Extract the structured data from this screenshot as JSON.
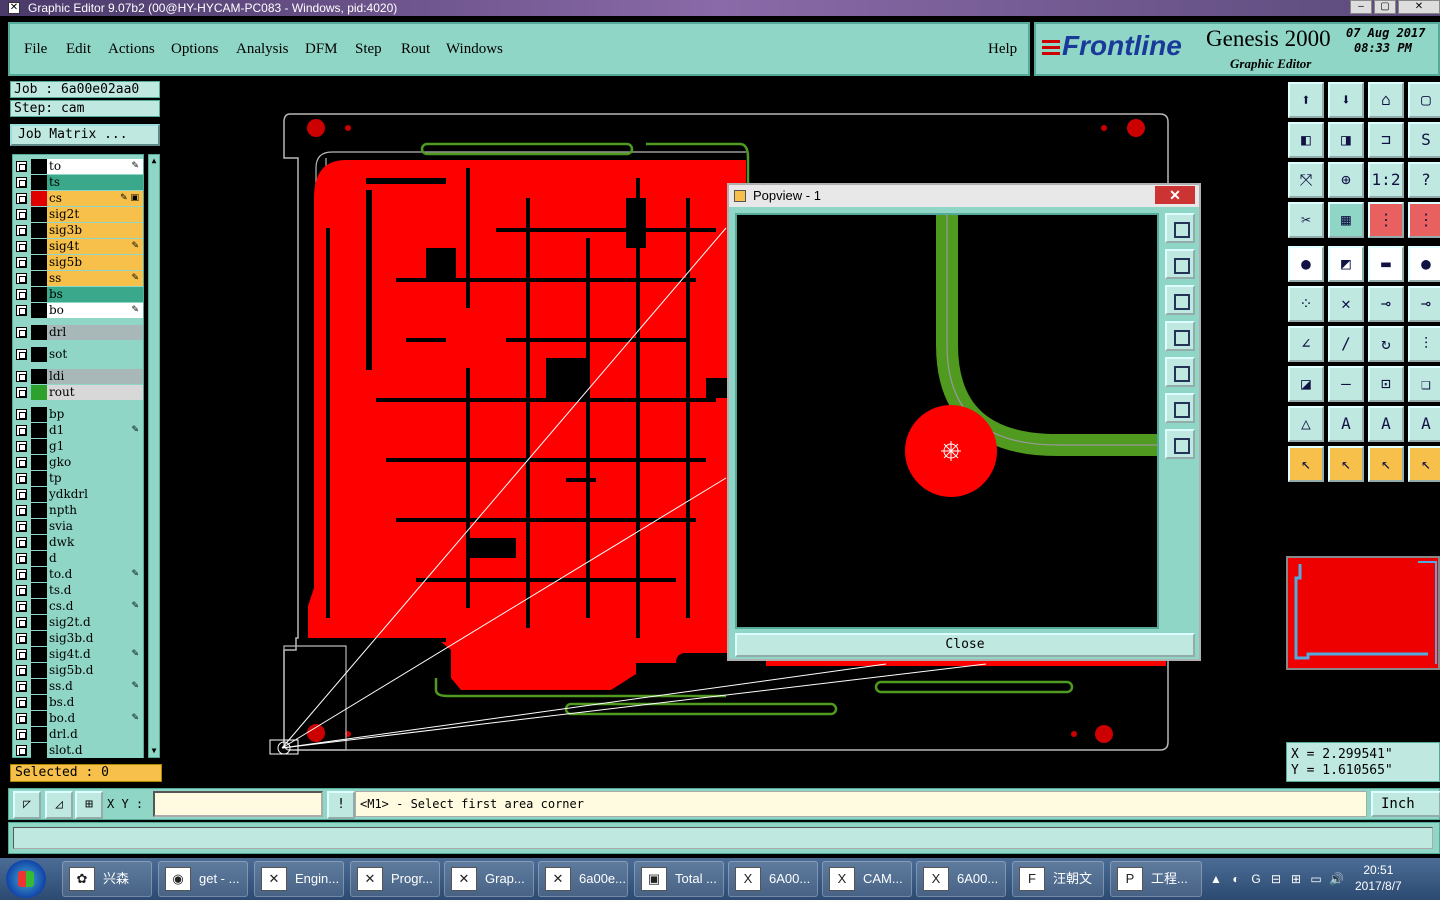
{
  "window": {
    "title": "Graphic Editor 9.07b2 (00@HY-HYCAM-PC083 - Windows, pid:4020)"
  },
  "menu": {
    "items": [
      "File",
      "Edit",
      "Actions",
      "Options",
      "Analysis",
      "DFM",
      "Step",
      "Rout",
      "Windows"
    ],
    "help": "Help"
  },
  "brand": {
    "logo": "Frontline",
    "product": "Genesis 2000",
    "subtitle": "Graphic Editor",
    "date": "07 Aug 2017",
    "time": "08:33 PM"
  },
  "job": {
    "job_line": "Job : 6a00e02aa0",
    "step_line": "Step: cam",
    "matrix_button": "Job Matrix ..."
  },
  "layers": [
    {
      "name": "to",
      "color": "#ffffff",
      "swatch": "#000000",
      "mark": "✎"
    },
    {
      "name": "ts",
      "color": "#3aa88a",
      "swatch": "#000000",
      "mark": ""
    },
    {
      "name": "cs",
      "color": "#f6c04a",
      "swatch": "#e00000",
      "mark": "✎ ▣"
    },
    {
      "name": "sig2t",
      "color": "#f6c04a",
      "swatch": "#000000",
      "mark": ""
    },
    {
      "name": "sig3b",
      "color": "#f6c04a",
      "swatch": "#000000",
      "mark": ""
    },
    {
      "name": "sig4t",
      "color": "#f6c04a",
      "swatch": "#000000",
      "mark": "✎"
    },
    {
      "name": "sig5b",
      "color": "#f6c04a",
      "swatch": "#000000",
      "mark": ""
    },
    {
      "name": "ss",
      "color": "#f6c04a",
      "swatch": "#000000",
      "mark": "✎"
    },
    {
      "name": "bs",
      "color": "#3aa88a",
      "swatch": "#000000",
      "mark": ""
    },
    {
      "name": "bo",
      "color": "#ffffff",
      "swatch": "#000000",
      "mark": "✎"
    },
    {
      "name": "drl",
      "color": "#a8b8b8",
      "swatch": "#000000",
      "mark": ""
    },
    {
      "name": "sot",
      "color": "#8fd6c6",
      "swatch": "#000000",
      "mark": ""
    },
    {
      "name": "ldi",
      "color": "#a8b8b8",
      "swatch": "#000000",
      "mark": ""
    },
    {
      "name": "rout",
      "color": "#d8d8d8",
      "swatch": "#2ea02e",
      "mark": ""
    },
    {
      "name": "bp",
      "color": "#8fd6c6",
      "swatch": "#000000",
      "mark": ""
    },
    {
      "name": "d1",
      "color": "#8fd6c6",
      "swatch": "#000000",
      "mark": "✎"
    },
    {
      "name": "g1",
      "color": "#8fd6c6",
      "swatch": "#000000",
      "mark": ""
    },
    {
      "name": "gko",
      "color": "#8fd6c6",
      "swatch": "#000000",
      "mark": ""
    },
    {
      "name": "tp",
      "color": "#8fd6c6",
      "swatch": "#000000",
      "mark": ""
    },
    {
      "name": "ydkdrl",
      "color": "#8fd6c6",
      "swatch": "#000000",
      "mark": ""
    },
    {
      "name": "npth",
      "color": "#8fd6c6",
      "swatch": "#000000",
      "mark": ""
    },
    {
      "name": "svia",
      "color": "#8fd6c6",
      "swatch": "#000000",
      "mark": ""
    },
    {
      "name": "dwk",
      "color": "#8fd6c6",
      "swatch": "#000000",
      "mark": ""
    },
    {
      "name": "d",
      "color": "#8fd6c6",
      "swatch": "#000000",
      "mark": ""
    },
    {
      "name": "to.d",
      "color": "#8fd6c6",
      "swatch": "#000000",
      "mark": "✎"
    },
    {
      "name": "ts.d",
      "color": "#8fd6c6",
      "swatch": "#000000",
      "mark": ""
    },
    {
      "name": "cs.d",
      "color": "#8fd6c6",
      "swatch": "#000000",
      "mark": "✎"
    },
    {
      "name": "sig2t.d",
      "color": "#8fd6c6",
      "swatch": "#000000",
      "mark": ""
    },
    {
      "name": "sig3b.d",
      "color": "#8fd6c6",
      "swatch": "#000000",
      "mark": ""
    },
    {
      "name": "sig4t.d",
      "color": "#8fd6c6",
      "swatch": "#000000",
      "mark": "✎"
    },
    {
      "name": "sig5b.d",
      "color": "#8fd6c6",
      "swatch": "#000000",
      "mark": ""
    },
    {
      "name": "ss.d",
      "color": "#8fd6c6",
      "swatch": "#000000",
      "mark": "✎"
    },
    {
      "name": "bs.d",
      "color": "#8fd6c6",
      "swatch": "#000000",
      "mark": ""
    },
    {
      "name": "bo.d",
      "color": "#8fd6c6",
      "swatch": "#000000",
      "mark": "✎"
    },
    {
      "name": "drl.d",
      "color": "#8fd6c6",
      "swatch": "#000000",
      "mark": ""
    },
    {
      "name": "slot.d",
      "color": "#8fd6c6",
      "swatch": "#000000",
      "mark": ""
    }
  ],
  "selected": "Selected : 0",
  "popview": {
    "title": "Popview - 1",
    "close_label": "Close",
    "x_label": "✕"
  },
  "toolbar": {
    "tools": [
      {
        "icon": "⬆",
        "bg": "#bfe8e0"
      },
      {
        "icon": "⬇",
        "bg": "#bfe8e0"
      },
      {
        "icon": "⌂",
        "bg": "#bfe8e0"
      },
      {
        "icon": "▢",
        "bg": "#bfe8e0"
      },
      {
        "icon": "◧",
        "bg": "#bfe8e0"
      },
      {
        "icon": "◨",
        "bg": "#bfe8e0"
      },
      {
        "icon": "⊐",
        "bg": "#bfe8e0"
      },
      {
        "icon": "S",
        "bg": "#bfe8e0"
      },
      {
        "icon": "⤧",
        "bg": "#bfe8e0"
      },
      {
        "icon": "⊕",
        "bg": "#bfe8e0"
      },
      {
        "icon": "1:2",
        "bg": "#bfe8e0"
      },
      {
        "icon": "?",
        "bg": "#bfe8e0"
      },
      {
        "icon": "✂",
        "bg": "#bfe8e0"
      },
      {
        "icon": "▦",
        "bg": "#8fd6c6"
      },
      {
        "icon": "⋮",
        "bg": "#e86060"
      },
      {
        "icon": "⋮",
        "bg": "#e86060"
      },
      {
        "icon": "●",
        "bg": "#ffffff"
      },
      {
        "icon": "◩",
        "bg": "#ffffff"
      },
      {
        "icon": "▬",
        "bg": "#ffffff"
      },
      {
        "icon": "●",
        "bg": "#ffffff"
      },
      {
        "icon": "⁘",
        "bg": "#bfe8e0"
      },
      {
        "icon": "✕",
        "bg": "#bfe8e0"
      },
      {
        "icon": "⊸",
        "bg": "#bfe8e0"
      },
      {
        "icon": "⊸",
        "bg": "#bfe8e0"
      },
      {
        "icon": "∠",
        "bg": "#bfe8e0"
      },
      {
        "icon": "∕",
        "bg": "#bfe8e0"
      },
      {
        "icon": "↻",
        "bg": "#bfe8e0"
      },
      {
        "icon": "⫶",
        "bg": "#bfe8e0"
      },
      {
        "icon": "◪",
        "bg": "#bfe8e0"
      },
      {
        "icon": "—",
        "bg": "#bfe8e0"
      },
      {
        "icon": "⊡",
        "bg": "#bfe8e0"
      },
      {
        "icon": "❏",
        "bg": "#bfe8e0"
      },
      {
        "icon": "△",
        "bg": "#bfe8e0"
      },
      {
        "icon": "A",
        "bg": "#bfe8e0"
      },
      {
        "icon": "A",
        "bg": "#bfe8e0"
      },
      {
        "icon": "A",
        "bg": "#bfe8e0"
      },
      {
        "icon": "↖",
        "bg": "#f6c04a"
      },
      {
        "icon": "↖",
        "bg": "#f6c04a"
      },
      {
        "icon": "↖",
        "bg": "#f6c04a"
      },
      {
        "icon": "↖",
        "bg": "#f6c04a"
      }
    ]
  },
  "coords": {
    "x": "X = 2.299541\"",
    "y": "Y = 1.610565\""
  },
  "command": {
    "xy_label": "X Y :",
    "xy_value": "",
    "prompt": "<M1> - Select first area corner",
    "unit": "Inch"
  },
  "taskbar": {
    "items": [
      {
        "label": "兴森快...",
        "icon": "✿"
      },
      {
        "label": "get - ...",
        "icon": "◉"
      },
      {
        "label": "Engin...",
        "icon": "✕"
      },
      {
        "label": "Progr...",
        "icon": "✕"
      },
      {
        "label": "Grap...",
        "icon": "✕"
      },
      {
        "label": "6a00e...",
        "icon": "✕"
      },
      {
        "label": "Total ...",
        "icon": "▣"
      },
      {
        "label": "6A00...",
        "icon": "X"
      },
      {
        "label": "CAM...",
        "icon": "X"
      },
      {
        "label": "6A00...",
        "icon": "X"
      },
      {
        "label": "汪朝文",
        "icon": "F"
      },
      {
        "label": "工程...",
        "icon": "P"
      }
    ],
    "tray_icons": [
      "▲",
      "◐",
      "G",
      "⊟",
      "⊞",
      "▭",
      "🔊"
    ],
    "time": "20:51",
    "date": "2017/8/7"
  },
  "colors": {
    "copper": "#ff0000",
    "rout": "#4f9a1f",
    "outline": "#b8b8b8",
    "panel": "#8fd6c6"
  }
}
